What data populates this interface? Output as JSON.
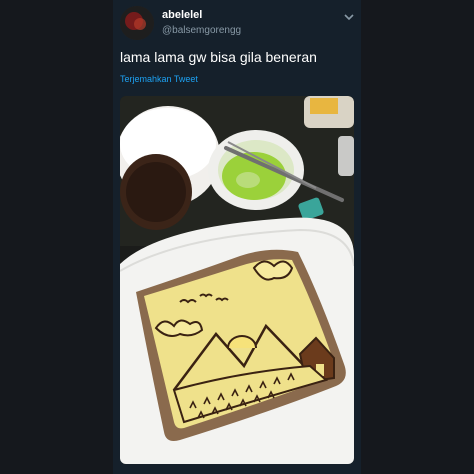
{
  "tweet": {
    "display_name": "abelelel",
    "handle": "@balsemgorengg",
    "text": "lama lama gw bisa gila beneran",
    "translate_label": "Terjemahkan Tweet",
    "photo_description": "Toast with chocolate-drawn mountain landscape on a plate, bowls of chocolate sprinkles and green paste",
    "menu_icon": "chevron-down-icon"
  },
  "colors": {
    "background": "#15181d",
    "card": "#15202b",
    "link": "#1da1f2",
    "secondary_text": "#8899a6"
  }
}
